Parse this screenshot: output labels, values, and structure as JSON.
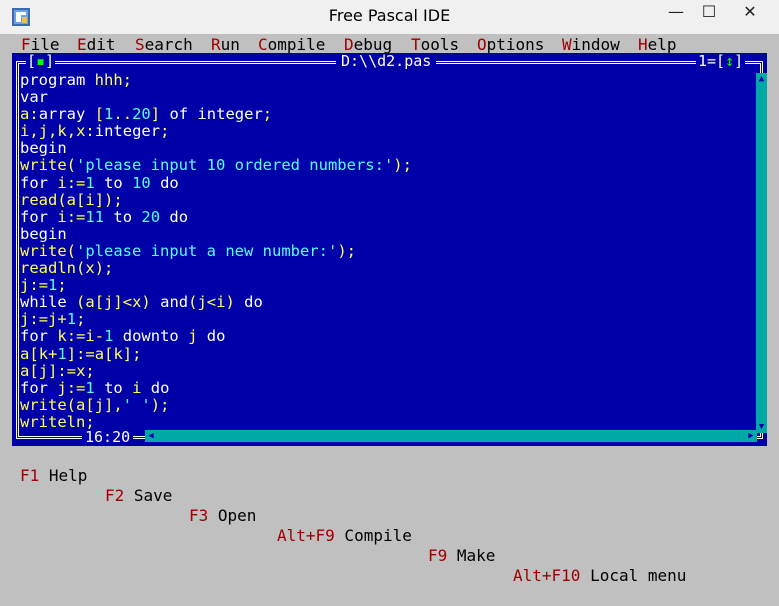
{
  "window": {
    "title": "Free Pascal IDE",
    "min_glyph": "—",
    "max_glyph": "☐",
    "close_glyph": "✕"
  },
  "menu": [
    {
      "hot": "F",
      "rest": "ile"
    },
    {
      "hot": "E",
      "rest": "dit"
    },
    {
      "hot": "S",
      "rest": "earch"
    },
    {
      "hot": "R",
      "rest": "un"
    },
    {
      "hot": "C",
      "rest": "ompile"
    },
    {
      "hot": "D",
      "rest": "ebug"
    },
    {
      "hot": "T",
      "rest": "ools"
    },
    {
      "hot": "O",
      "rest": "ptions"
    },
    {
      "hot": "W",
      "rest": "indow"
    },
    {
      "hot": "H",
      "rest": "elp"
    }
  ],
  "editor": {
    "close_box_left": "[",
    "close_box_mark": "▪",
    "close_box_right": "]",
    "filename": "D:\\\\d2.pas",
    "window_number": "1=[",
    "window_zoom": "↕",
    "window_number_end": "]",
    "cursor_position": "16:20",
    "code_lines": [
      "program hhh;",
      "var",
      "a:array [1..20] of integer;",
      "i,j,k,x:integer;",
      "begin",
      "write('please input 10 ordered numbers:');",
      "for i:=1 to 10 do",
      "read(a[i]);",
      "for i:=11 to 20 do",
      "begin",
      "write('please input a new number:');",
      "readln(x);",
      "j:=1;",
      "while (a[j]<x) and(j<i) do",
      "j:=j+1;",
      "for k:=i-1 downto j do",
      "a[k+1]:=a[k];",
      "a[j]:=x;",
      "for j:=1 to i do",
      "write(a[j],' ');",
      "writeln;"
    ]
  },
  "status": [
    {
      "key": "F1",
      "label": " Help"
    },
    {
      "key": "F2",
      "label": " Save"
    },
    {
      "key": "F3",
      "label": " Open"
    },
    {
      "key": "Alt+F9",
      "label": " Compile"
    },
    {
      "key": "F9",
      "label": " Make"
    },
    {
      "key": "Alt+F10",
      "label": " Local menu"
    }
  ],
  "colors": {
    "editor_bg": "#0000a8",
    "keyword": "#ffffff",
    "identifier": "#ffff55",
    "literal": "#55ffff",
    "hotkey": "#a00000"
  }
}
